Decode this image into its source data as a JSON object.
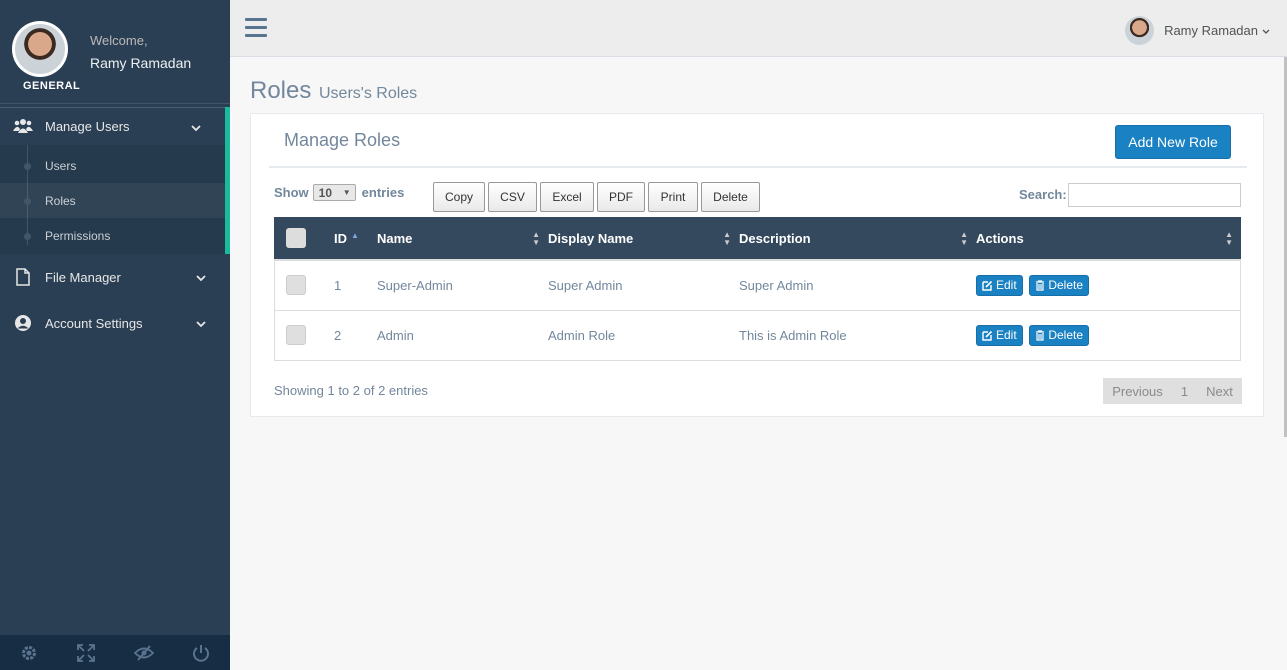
{
  "sidebar": {
    "welcome": "Welcome,",
    "user_name": "Ramy Ramadan",
    "section": "GENERAL",
    "menu": {
      "manage_users": "Manage Users",
      "sub": [
        "Users",
        "Roles",
        "Permissions"
      ],
      "file_manager": "File Manager",
      "account_settings": "Account Settings"
    },
    "footer_icons": [
      "gear-icon",
      "fullscreen-icon",
      "eye-slash-icon",
      "power-icon"
    ]
  },
  "topnav": {
    "user_name": "Ramy Ramadan"
  },
  "page": {
    "title": "Roles",
    "subtitle": "Users's Roles"
  },
  "panel": {
    "title": "Manage Roles",
    "add_button": "Add New Role",
    "show_label": "Show",
    "page_size": "10",
    "entries_label": "entries",
    "export_buttons": [
      "Copy",
      "CSV",
      "Excel",
      "PDF",
      "Print",
      "Delete"
    ],
    "search_label": "Search:",
    "search_value": "",
    "columns": [
      "ID",
      "Name",
      "Display Name",
      "Description",
      "Actions"
    ],
    "rows": [
      {
        "id": "1",
        "name": "Super-Admin",
        "display_name": "Super Admin",
        "description": "Super Admin"
      },
      {
        "id": "2",
        "name": "Admin",
        "display_name": "Admin Role",
        "description": "This is Admin Role"
      }
    ],
    "row_actions": {
      "edit": "Edit",
      "delete": "Delete"
    },
    "info": "Showing 1 to 2 of 2 entries",
    "pager": {
      "previous": "Previous",
      "page": "1",
      "next": "Next"
    }
  },
  "colors": {
    "sidebar_bg": "#2a3f54",
    "accent": "#1abb9c",
    "primary_button": "#1a82c3",
    "table_header": "#34495e"
  }
}
